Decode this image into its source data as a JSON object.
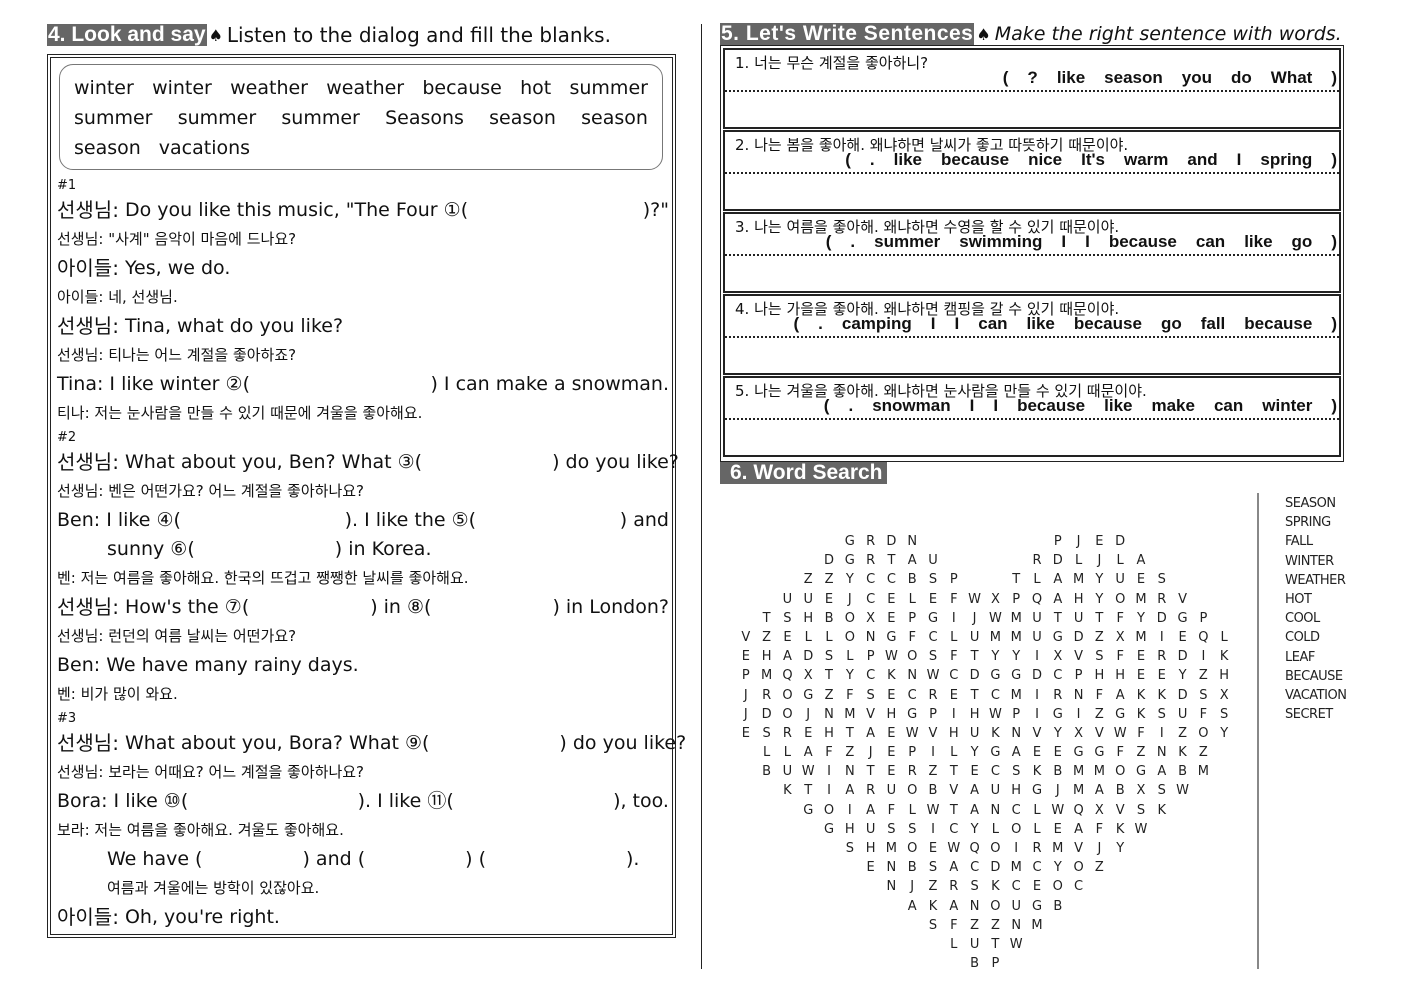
{
  "section4": {
    "tag": "4. Look and say",
    "spade": "♠",
    "instruction": "Listen to the dialog and fill the blanks.",
    "word_bank": [
      [
        "winter",
        "winter",
        "weather",
        "weather",
        "because",
        "hot",
        "summer"
      ],
      [
        "summer",
        "summer",
        "summer",
        "Seasons",
        "season",
        "season"
      ],
      [
        "season",
        "vacations"
      ]
    ],
    "scenes": [
      {
        "label": "#1",
        "lines": [
          {
            "type": "en",
            "speaker": "선생님:",
            "parts": [
              "Do you like this music, \"The Four ①(",
              ")?\""
            ]
          },
          {
            "type": "ko",
            "text": "선생님: \"사계\" 음악이 마음에 드나요?"
          },
          {
            "type": "en",
            "speaker": "아이들:",
            "parts": [
              "Yes, we do."
            ]
          },
          {
            "type": "ko",
            "text": "아이들: 네, 선생님."
          },
          {
            "type": "en",
            "speaker": "선생님:",
            "parts": [
              "Tina, what  do you like?"
            ]
          },
          {
            "type": "ko",
            "text": "선생님: 티나는 어느 계절을 좋아하죠?"
          },
          {
            "type": "en",
            "speaker": "",
            "parts": [
              "Tina: I like winter ②(",
              ") I can make a snowman."
            ]
          },
          {
            "type": "ko",
            "text": "티나: 저는 눈사람을 만들 수 있기 때문에 겨울을 좋아해요."
          }
        ]
      },
      {
        "label": "#2",
        "lines": [
          {
            "type": "en",
            "speaker": "선생님:",
            "parts": [
              "What about you, Ben? What ③(",
              ") do you like?"
            ]
          },
          {
            "type": "ko",
            "text": "선생님: 벤은 어떤가요? 어느 계절을 좋아하나요?"
          },
          {
            "type": "en",
            "speaker": "",
            "parts": [
              "Ben: I like ④(",
              "). I like the ⑤(",
              ") and"
            ]
          },
          {
            "type": "en",
            "speaker": "",
            "parts": [
              "sunny ⑥(",
              ") in Korea."
            ]
          },
          {
            "type": "ko",
            "text": "벤: 저는 여름을 좋아해요. 한국의 뜨겁고 쨍쨍한 날씨를 좋아해요."
          },
          {
            "type": "en",
            "speaker": "선생님:",
            "parts": [
              "How's the ⑦(",
              ") in ⑧(",
              ") in London?"
            ]
          },
          {
            "type": "ko",
            "text": "선생님: 런던의 여름 날씨는 어떤가요?"
          },
          {
            "type": "en",
            "speaker": "",
            "parts": [
              "Ben: We have many rainy days."
            ]
          },
          {
            "type": "ko",
            "text": "벤: 비가 많이 와요."
          }
        ]
      },
      {
        "label": "#3",
        "lines": [
          {
            "type": "en",
            "speaker": "선생님:",
            "parts": [
              "What about you, Bora? What ⑨(",
              ") do you like?"
            ]
          },
          {
            "type": "ko",
            "text": "선생님: 보라는 어때요? 어느 계절을 좋아하나요?"
          },
          {
            "type": "en",
            "speaker": "",
            "parts": [
              "Bora: I like ⑩(",
              "). I like ⑪(",
              "), too."
            ]
          },
          {
            "type": "ko",
            "text": "보라: 저는 여름을 좋아해요. 겨울도 좋아해요."
          },
          {
            "type": "en",
            "speaker": "",
            "parts": [
              "We have (",
              ") and (",
              ") (",
              ")."
            ]
          },
          {
            "type": "ko",
            "text": "여름과 겨울에는 방학이 있잖아요."
          },
          {
            "type": "en",
            "speaker": "아이들:",
            "parts": [
              "Oh, you're right."
            ]
          }
        ]
      }
    ]
  },
  "section5": {
    "tag": "5. Let's Write Sentences",
    "spade": "♠",
    "instruction": "Make the right sentence with words.",
    "questions": [
      {
        "prompt": "1. 너는 무슨 계절을 좋아하니?",
        "words": [
          "?",
          "like",
          "season",
          "you",
          "do",
          "What"
        ]
      },
      {
        "prompt": "2. 나는 봄을 좋아해. 왜냐하면 날씨가 좋고 따뜻하기 때문이야.",
        "words": [
          ".",
          "like",
          "because",
          "nice",
          "It's",
          "warm",
          "and",
          "I",
          "spring"
        ]
      },
      {
        "prompt": "3. 나는 여름을 좋아해. 왜냐하면 수영을 할 수 있기 때문이야.",
        "words": [
          ".",
          "summer",
          "swimming",
          "I",
          "I",
          "because",
          "can",
          "like",
          "go"
        ]
      },
      {
        "prompt": "4. 나는 가을을 좋아해. 왜냐하면 캠핑을 갈 수 있기 때문이야.",
        "words": [
          ".",
          "camping",
          "I",
          "I",
          "can",
          "like",
          "because",
          "go",
          "fall",
          "because"
        ]
      },
      {
        "prompt": "5. 나는 겨울을 좋아해. 왜냐하면 눈사람을 만들 수 있기 때문이야.",
        "words": [
          ".",
          "snowman",
          "I",
          "I",
          "because",
          "like",
          "make",
          "can",
          "winter"
        ]
      }
    ]
  },
  "section6": {
    "tag": "6. Word Search",
    "grid": [
      "   GRDN      PJED    ",
      "  DGRTAU    RDLJLA   ",
      " ZZYCCBSP  TLAMYUES  ",
      "UUEJCELEFWXPQAHYOMRV ",
      "TSHBOXEPGIJWMUTUTFYDGP",
      "VZELLONGFCLUMMUGDZXMIEQL",
      "EHADSLPWOSFTYYIXVSFERDIK",
      "PMQXTYCKNWCDGGDCPHHEEYZH",
      "JROGZFSECRETCMIRNFAKKDSX",
      "JDOJNMVHGPIHWPIGIZGKSUFS",
      "ESREHTAEWVHUKNVYXVWFIZOY",
      "LLAFZJEPILYGAEEGGFZNKZ",
      "BUWINTERZTECSKBMMOGABM",
      "KTIARUOBVAUHGJMABXSW",
      "GOIAFLWTANCLWQXVSK",
      "GHUSSICYLOLEAFKW",
      "SHMOEWQOIRMVJY",
      "ENBSACDMCYOZ",
      "NJZRSKCEOC",
      "AKANOUGB",
      "SFZZNM",
      "LUTW",
      "BP"
    ],
    "word_list": [
      "SEASON",
      "SPRING",
      "FALL",
      "WINTER",
      "WEATHER",
      "HOT",
      "COOL",
      "COLD",
      "LEAF",
      "BECAUSE",
      "VACATION",
      "SECRET"
    ]
  }
}
